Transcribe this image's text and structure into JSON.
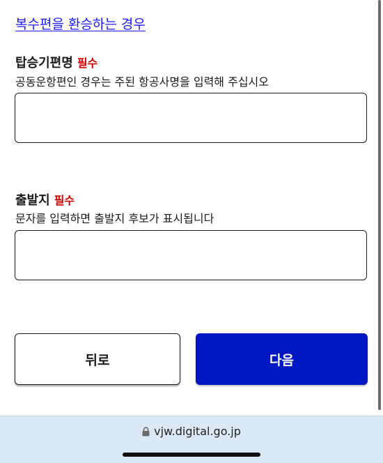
{
  "links": {
    "multiple_flights": "복수편을 환승하는 경우"
  },
  "fields": {
    "flight_name": {
      "label": "탑승기편명",
      "required": "필수",
      "hint": "공동운항편인 경우는 주된 항공사명을 입력해 주십시오",
      "value": "",
      "placeholder": ""
    },
    "departure": {
      "label": "출발지",
      "required": "필수",
      "hint": "문자를 입력하면 출발지 후보가 표시됩니다",
      "value": "",
      "placeholder": ""
    }
  },
  "buttons": {
    "back": "뒤로",
    "next": "다음"
  },
  "browser": {
    "url": "vjw.digital.go.jp"
  },
  "colors": {
    "primary": "#0017c1",
    "required": "#d40000",
    "link": "#1a1aff",
    "address_bar": "#dbe8f5"
  },
  "icons": {
    "lock": "lock-icon"
  }
}
